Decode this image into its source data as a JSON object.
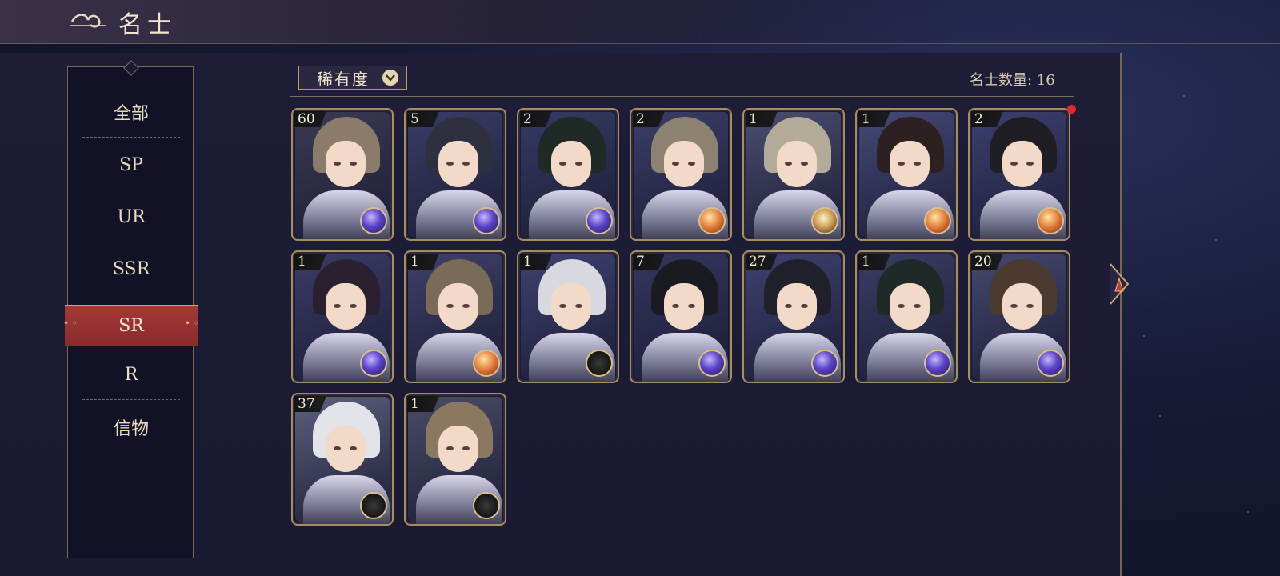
{
  "header": {
    "title": "名士"
  },
  "sidebar": {
    "categories": [
      {
        "label": "全部",
        "active": false
      },
      {
        "label": "SP",
        "active": false
      },
      {
        "label": "UR",
        "active": false
      },
      {
        "label": "SSR",
        "active": false
      },
      {
        "label": "SR",
        "active": true
      },
      {
        "label": "R",
        "active": false
      },
      {
        "label": "信物",
        "active": false
      }
    ]
  },
  "toolbar": {
    "filter_label": "稀有度",
    "count_text": "名士数量: 16"
  },
  "colors": {
    "accent_red": "#9a3133",
    "gold_border": "#b89a68",
    "panel": "#1e1d37"
  },
  "cards": [
    {
      "level": "60",
      "gem": "purple-orb",
      "hair": "#8a7b6a",
      "bg": "#3b3a52"
    },
    {
      "level": "5",
      "gem": "purple-orb",
      "hair": "#2e3040",
      "bg": "#3a3d66"
    },
    {
      "level": "2",
      "gem": "purple-orb",
      "hair": "#1f2a26",
      "bg": "#363a63"
    },
    {
      "level": "2",
      "gem": "gold-orb",
      "hair": "#8d8272",
      "bg": "#3b3d68"
    },
    {
      "level": "1",
      "gem": "gold-coin",
      "hair": "#b3aa9a",
      "bg": "#4a4e6e"
    },
    {
      "level": "1",
      "gem": "gold-orb",
      "hair": "#2c2020",
      "bg": "#454a78"
    },
    {
      "level": "2",
      "gem": "gold-orb",
      "hair": "#1e1e24",
      "bg": "#3c4070"
    },
    {
      "level": "1",
      "gem": "purple-orb",
      "hair": "#2a2030",
      "bg": "#3a3c66"
    },
    {
      "level": "1",
      "gem": "gold-orb",
      "hair": "#7a6a58",
      "bg": "#3f4068"
    },
    {
      "level": "1",
      "gem": "dark-medal",
      "hair": "#d8d8e0",
      "bg": "#3e4170"
    },
    {
      "level": "7",
      "gem": "purple-orb",
      "hair": "#1a1a22",
      "bg": "#34365e"
    },
    {
      "level": "27",
      "gem": "purple-orb",
      "hair": "#20202a",
      "bg": "#3e4170"
    },
    {
      "level": "1",
      "gem": "purple-orb",
      "hair": "#1f2a28",
      "bg": "#3a3d64"
    },
    {
      "level": "20",
      "gem": "purple-orb",
      "hair": "#4a3a30",
      "bg": "#45486e"
    },
    {
      "level": "37",
      "gem": "dark-medal",
      "hair": "#e2e4ea",
      "bg": "#5d617e"
    },
    {
      "level": "1",
      "gem": "dark-medal",
      "hair": "#8a7860",
      "bg": "#4b4c66"
    }
  ]
}
